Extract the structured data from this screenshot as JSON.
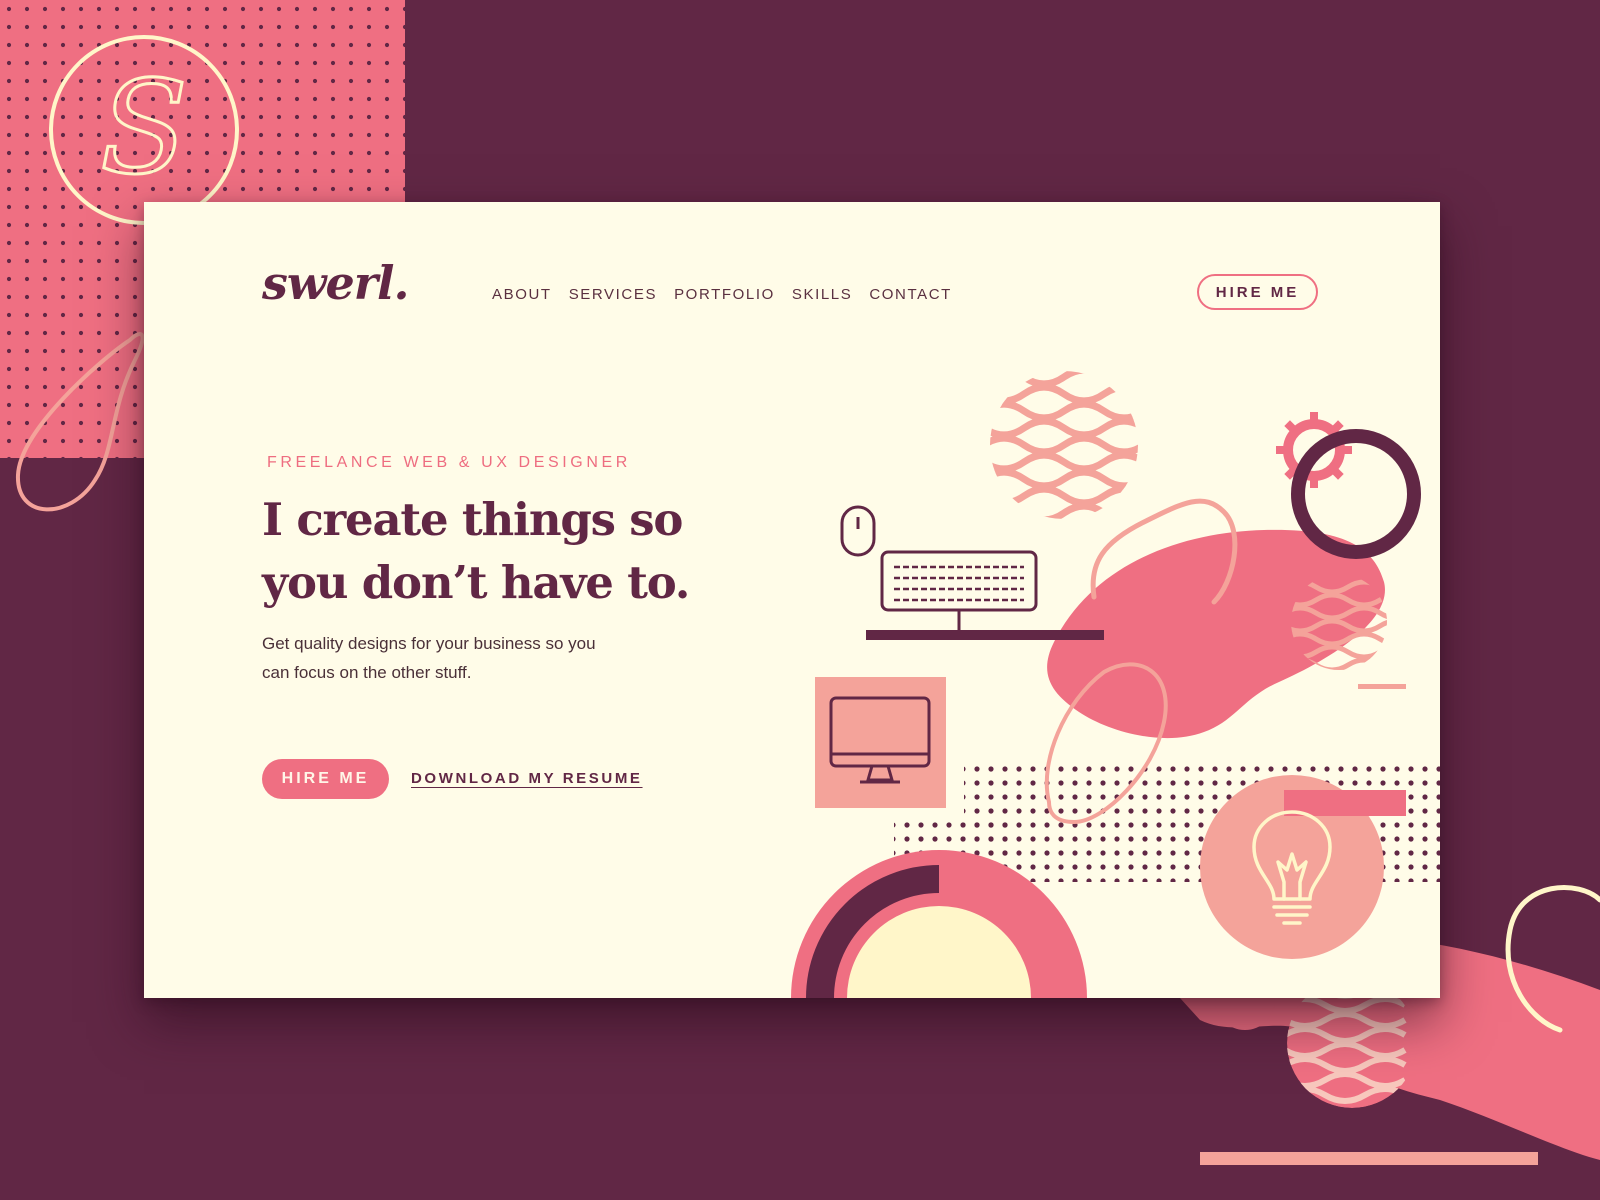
{
  "brand": {
    "logo": "swerl.",
    "monogram": "S"
  },
  "nav": {
    "items": [
      {
        "label": "ABOUT"
      },
      {
        "label": "SERVICES"
      },
      {
        "label": "PORTFOLIO"
      },
      {
        "label": "SKILLS"
      },
      {
        "label": "CONTACT"
      }
    ],
    "hire_label": "HIRE ME"
  },
  "hero": {
    "eyebrow": "FREELANCE WEB & UX DESIGNER",
    "headline": "I create things so you don’t have to.",
    "subtext": "Get quality designs for your business so you can focus on the other stuff.",
    "primary_cta": "HIRE ME",
    "secondary_cta": "DOWNLOAD MY RESUME"
  },
  "illustration_icons": [
    "mouse-icon",
    "keyboard-icon",
    "desktop-monitor-icon",
    "lightbulb-icon",
    "gear-icon"
  ],
  "colors": {
    "background": "#612745",
    "card": "#fffce8",
    "pink": "#ef6f82",
    "salmon": "#f4a39a",
    "plum": "#612745",
    "cream": "#fff6c9"
  }
}
